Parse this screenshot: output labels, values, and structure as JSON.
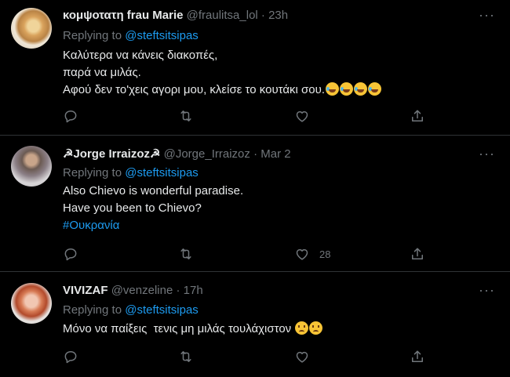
{
  "tweets": [
    {
      "name": "κομψοτατη frau Marie",
      "handle": "@fraulitsa_lol",
      "time": "23h",
      "replying_to": "Replying to",
      "mention": "@steftsitsipas",
      "lines": [
        "Καλύτερα να κάνεις διακοπές,",
        "παρά να μιλάς.",
        "Αφού δεν το'χεις αγορι μου, κλείσε το κουτάκι σου."
      ],
      "emoji": [
        "rolling-on-floor-laughing",
        "rolling-on-floor-laughing",
        "rolling-on-floor-laughing",
        "rolling-on-floor-laughing"
      ],
      "like_count": ""
    },
    {
      "name": "☭Jorge Irraizoz☭",
      "handle": "@Jorge_Irraizoz",
      "time": "Mar 2",
      "replying_to": "Replying to",
      "mention": "@steftsitsipas",
      "lines": [
        "Also Chievo is wonderful paradise.",
        "Have you been to Chievo?"
      ],
      "hashtag": "#Ουκρανία",
      "like_count": "28"
    },
    {
      "name": "VIVIZAF",
      "handle": "@venzeline",
      "time": "17h",
      "replying_to": "Replying to",
      "mention": "@steftsitsipas",
      "lines": [
        "Μόνο να παίξεις  τενις μη μιλάς τουλάχιστον"
      ],
      "emoji": [
        "frowning-face",
        "frowning-face"
      ],
      "like_count": ""
    }
  ],
  "separator": "·",
  "icons": {
    "reply": "reply-icon",
    "retweet": "retweet-icon",
    "like": "like-icon",
    "share": "share-icon",
    "more": "more-icon"
  },
  "colors": {
    "background": "#000000",
    "text": "#e7e9ea",
    "secondary": "#71767b",
    "link": "#1d9bf0",
    "divider": "#2f3336"
  }
}
